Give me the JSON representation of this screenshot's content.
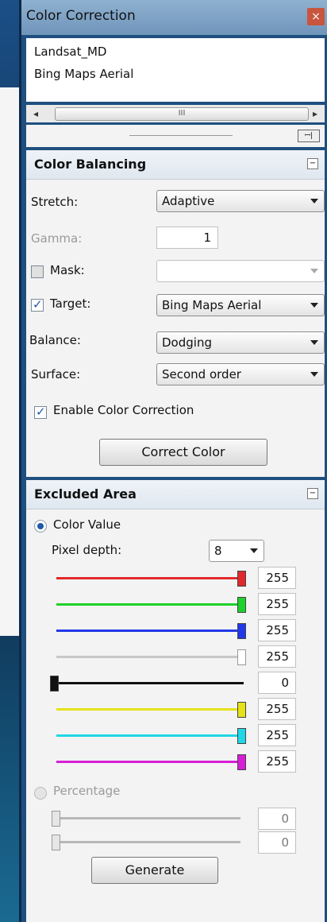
{
  "window": {
    "title": "Color Correction",
    "close": "×"
  },
  "layers": [
    "Landsat_MD",
    "Bing Maps Aerial"
  ],
  "scroll": {
    "left": "◂",
    "right": "▸",
    "grip": "III"
  },
  "pin": "ꟷ|",
  "color_balancing": {
    "title": "Color Balancing",
    "toggle": "−",
    "stretch": {
      "label": "Stretch:",
      "value": "Adaptive"
    },
    "gamma": {
      "label": "Gamma:",
      "value": "1"
    },
    "mask": {
      "label": "Mask:",
      "value": "",
      "checked": false
    },
    "target": {
      "label": "Target:",
      "value": "Bing Maps Aerial",
      "checked": true
    },
    "balance": {
      "label": "Balance:",
      "value": "Dodging"
    },
    "surface": {
      "label": "Surface:",
      "value": "Second order"
    },
    "enable": {
      "label": "Enable Color Correction",
      "checked": true
    },
    "correct_button": "Correct Color"
  },
  "excluded_area": {
    "title": "Excluded Area",
    "toggle": "−",
    "color_value_label": "Color Value",
    "pixel_depth_label": "Pixel depth:",
    "pixel_depth_value": "8",
    "channels": [
      {
        "name": "red",
        "color": "#e0292b",
        "value": "255",
        "level": 1.0
      },
      {
        "name": "green",
        "color": "#1fd12b",
        "value": "255",
        "level": 1.0
      },
      {
        "name": "blue",
        "color": "#2138e8",
        "value": "255",
        "level": 1.0
      },
      {
        "name": "gray",
        "color": "#c8c8c8",
        "value": "255",
        "level": 1.0
      },
      {
        "name": "black",
        "color": "#111111",
        "value": "0",
        "level": 0.0
      },
      {
        "name": "yellow",
        "color": "#e6e21a",
        "value": "255",
        "level": 1.0
      },
      {
        "name": "cyan",
        "color": "#21d6e6",
        "value": "255",
        "level": 1.0
      },
      {
        "name": "magenta",
        "color": "#d61fd6",
        "value": "255",
        "level": 1.0
      }
    ],
    "percentage_label": "Percentage",
    "percentages": [
      {
        "value": "0",
        "level": 0.0
      },
      {
        "value": "0",
        "level": 0.0
      }
    ],
    "generate_button": "Generate"
  }
}
